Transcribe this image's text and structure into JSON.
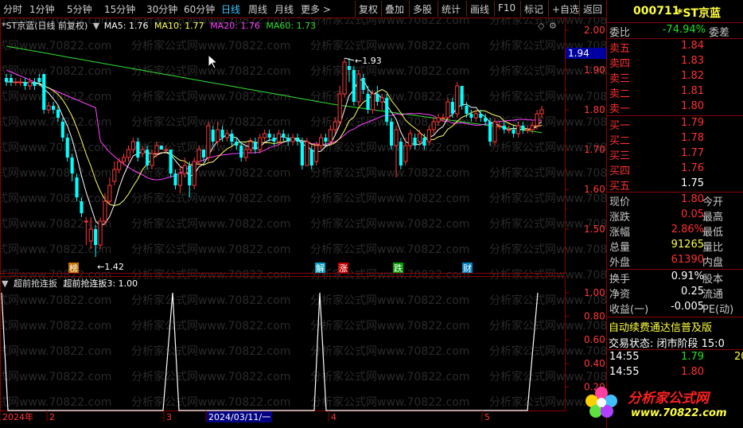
{
  "toolbar": {
    "left": [
      "分时",
      "1分钟",
      "5分钟",
      "15分钟",
      "30分钟",
      "60分钟",
      "日线",
      "周线",
      "月线",
      "更多 >"
    ],
    "active_index": 6,
    "right": [
      "复权",
      "叠加",
      "多股",
      "统计",
      "画线",
      "F10",
      "标记",
      "+自选",
      "返回"
    ]
  },
  "main_legend": {
    "name": "*ST京蓝(日线 前复权)",
    "ma5": "MA5: 1.76",
    "ma10": "MA10: 1.77",
    "ma20": "MA20: 1.76",
    "ma60": "MA60: 1.73"
  },
  "price_axis": [
    "2.00",
    "1.90",
    "1.80",
    "1.70",
    "1.60",
    "1.50"
  ],
  "current_price_tag": "1.94",
  "annotations": {
    "high": "1.93",
    "low": "1.42"
  },
  "markers": [
    "榜",
    "解",
    "涨",
    "跌",
    "财"
  ],
  "indicator_legend": {
    "name": "超前抢连扳",
    "value": "超前抢连扳3: 1.00"
  },
  "indicator_axis": [
    "1.00",
    "0.80",
    "0.60",
    "0.40",
    "0.20"
  ],
  "date_axis": [
    "2024年",
    "2",
    "3",
    "2024/03/11/一",
    "4",
    "5"
  ],
  "watermark": "分析家公式网www.70822.com",
  "colors": {
    "up": "#ff3838",
    "down": "#00ffff",
    "ma5": "#ffffff",
    "ma10": "#ffff60",
    "ma20": "#ff40ff",
    "ma60": "#30e030",
    "frame": "#8a0000"
  },
  "panel": {
    "code": "000711",
    "name": "*ST京蓝",
    "weibi_label": "委比",
    "weibi_value": "-74.94%",
    "weicha_label": "委差",
    "asks": [
      {
        "label": "卖五",
        "price": "1.84"
      },
      {
        "label": "卖四",
        "price": "1.83"
      },
      {
        "label": "卖三",
        "price": "1.82"
      },
      {
        "label": "卖二",
        "price": "1.81"
      },
      {
        "label": "卖一",
        "price": "1.80"
      }
    ],
    "bids": [
      {
        "label": "买一",
        "price": "1.79"
      },
      {
        "label": "买二",
        "price": "1.78"
      },
      {
        "label": "买三",
        "price": "1.77"
      },
      {
        "label": "买四",
        "price": "1.76"
      },
      {
        "label": "买五",
        "price": "1.75"
      }
    ],
    "stats": [
      {
        "label": "现价",
        "value": "1.80",
        "color": "red",
        "label2": "今开"
      },
      {
        "label": "涨跌",
        "value": "0.05",
        "color": "red",
        "label2": "最高"
      },
      {
        "label": "涨幅",
        "value": "2.86%",
        "color": "red",
        "label2": "最低"
      },
      {
        "label": "总量",
        "value": "91265",
        "color": "yel",
        "label2": "量比"
      },
      {
        "label": "外盘",
        "value": "61390",
        "color": "red",
        "label2": "内盘"
      }
    ],
    "stats2": [
      {
        "label": "换手",
        "value": "0.91%",
        "label2": "股本"
      },
      {
        "label": "净资",
        "value": "0.25",
        "label2": "流通"
      },
      {
        "label": "收益(一)",
        "value": "-0.005",
        "label2": "PE(动)"
      }
    ],
    "notice": "自动续费通达信普及版",
    "trade_status": "交易状态: 闭市阶段 15:0",
    "ticks": [
      {
        "time": "14:55",
        "price": "1.79",
        "price_color": "grn",
        "vol": "20"
      },
      {
        "time": "14:55",
        "price": "1.80",
        "price_color": "red",
        "vol": ""
      }
    ],
    "logo_text": "分析家公式网",
    "logo_url": "www.70822.com"
  }
}
